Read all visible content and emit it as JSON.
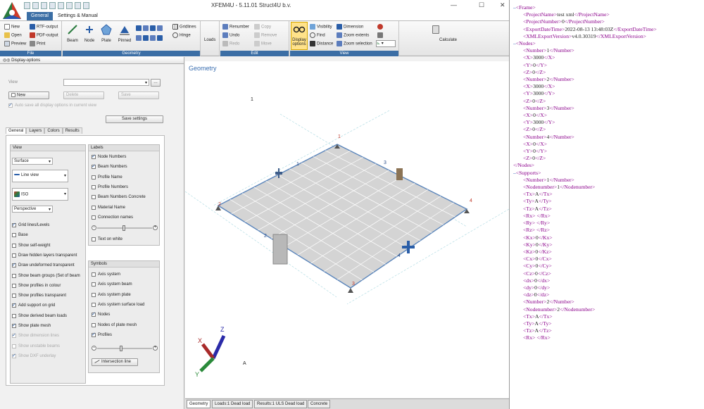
{
  "app": {
    "title": "XFEM4U  -  5.11.01     Struct4U b.v."
  },
  "window_controls": {
    "min": "—",
    "max": "☐",
    "close": "✕"
  },
  "tabs": [
    "General",
    "Settings & Manual"
  ],
  "ribbon": {
    "file": {
      "label": "File",
      "new": "New",
      "open": "Open",
      "preview": "Preview",
      "rtf": "RTF-output",
      "pdf": "PDF-output",
      "print": "Print"
    },
    "geometry": {
      "label": "Geometry",
      "beam": "Beam",
      "node": "Node",
      "plate": "Plate",
      "pinned": "Pinned",
      "gridlines": "Gridlines",
      "hinge": "Hinge"
    },
    "loads": {
      "label": "Loads"
    },
    "edit": {
      "label": "Edit",
      "renumber": "Renumber",
      "undo": "Undo",
      "redo": "Redo",
      "copy": "Copy",
      "remove": "Remove",
      "move": "Move"
    },
    "view": {
      "label": "View",
      "display_options": "Display options",
      "visibility": "Visibility",
      "find": "Find",
      "distance": "Distance",
      "dimension": "Dimension",
      "zoom_extents": "Zoom extents",
      "zoom_selection": "Zoom selection"
    },
    "calculate": {
      "label": "Calculate"
    }
  },
  "panel": {
    "title": "Display-options",
    "view_label": "View",
    "new_btn": "New",
    "delete_btn": "Delete",
    "save_btn": "Save",
    "auto_save": "Auto save all display options in current view",
    "save_settings": "Save settings",
    "tabs": [
      "General",
      "Layers",
      "Colors",
      "Results"
    ],
    "view_group": {
      "title": "View",
      "surface": "Surface",
      "line_view": "Line view",
      "iso": "ISO",
      "perspective": "Perspective"
    },
    "view_checks": [
      {
        "label": "Grid lines/Levels",
        "checked": true,
        "disabled": false
      },
      {
        "label": "Base",
        "checked": false,
        "disabled": false
      },
      {
        "label": "Show self-weight",
        "checked": false,
        "disabled": false
      },
      {
        "label": "Draw hidden layers transparent",
        "checked": false,
        "disabled": false
      },
      {
        "label": "Draw undeformed transparent",
        "checked": true,
        "disabled": false
      },
      {
        "label": "Show beam groups (Set of beam",
        "checked": false,
        "disabled": false
      },
      {
        "label": "Show profiles in colour",
        "checked": false,
        "disabled": false
      },
      {
        "label": "Show profiles transparent",
        "checked": false,
        "disabled": false
      },
      {
        "label": "Add support on grid",
        "checked": true,
        "disabled": false
      },
      {
        "label": "Show derived beam loads",
        "checked": false,
        "disabled": false
      },
      {
        "label": "Show plate mesh",
        "checked": true,
        "disabled": false
      },
      {
        "label": "Show dimension lines",
        "checked": true,
        "disabled": true
      },
      {
        "label": "Show unstable beams",
        "checked": false,
        "disabled": true
      },
      {
        "label": "Show DXF underlay",
        "checked": true,
        "disabled": true
      }
    ],
    "labels_group": {
      "title": "Labels",
      "checks": [
        {
          "label": "Node Numbers",
          "checked": true
        },
        {
          "label": "Beam Numbers",
          "checked": true
        },
        {
          "label": "Profile Name",
          "checked": false
        },
        {
          "label": "Profile Numbers",
          "checked": false
        },
        {
          "label": "Beam Numbers Concrete",
          "checked": false
        },
        {
          "label": "Material Name",
          "checked": false
        },
        {
          "label": "Connection names",
          "checked": false
        }
      ],
      "text_on_white": "Text on white"
    },
    "symbols_group": {
      "title": "Symbols",
      "checks": [
        {
          "label": "Axis system",
          "checked": false
        },
        {
          "label": "Axis system beam",
          "checked": false
        },
        {
          "label": "Axis system plate",
          "checked": false
        },
        {
          "label": "Axis system surface load",
          "checked": false
        },
        {
          "label": "Nodes",
          "checked": true
        },
        {
          "label": "Nodes of plate mesh",
          "checked": false
        },
        {
          "label": "Profiles",
          "checked": true
        }
      ],
      "intersection": "Intersection line"
    }
  },
  "viewport": {
    "label": "Geometry",
    "marker": "1",
    "node_labels": [
      "1",
      "2",
      "3",
      "4"
    ],
    "beam_labels": [
      "1",
      "2",
      "3",
      "4"
    ],
    "axes": {
      "x": "X",
      "y": "Y",
      "z": "Z"
    },
    "corner_label": "A"
  },
  "bottom_tabs": [
    "Geometry",
    "Loads:1 Dead load",
    "Results:1 ULS Dead load",
    "Concrete"
  ],
  "xml_lines": [
    {
      "indent": 0,
      "marker": "–",
      "text": "<Frame>"
    },
    {
      "indent": 1,
      "text": "<ProjectName>test xml</ProjectName>"
    },
    {
      "indent": 1,
      "text": "<ProjectNumber>0</ProjectNumber>"
    },
    {
      "indent": 1,
      "text": "<ExportDateTime>2022-08-13 13:48:03Z</ExportDateTime>"
    },
    {
      "indent": 1,
      "text": "<XMLExportVersion>v4.0.30319</XMLExportVersion>"
    },
    {
      "indent": 0,
      "marker": "–",
      "text": "<Nodes>"
    },
    {
      "indent": 1,
      "text": "<Number>1</Number>"
    },
    {
      "indent": 1,
      "text": "<X>3000</X>"
    },
    {
      "indent": 1,
      "text": "<Y>0</Y>"
    },
    {
      "indent": 1,
      "text": "<Z>0</Z>"
    },
    {
      "indent": 1,
      "text": "<Number>2</Number>"
    },
    {
      "indent": 1,
      "text": "<X>3000</X>"
    },
    {
      "indent": 1,
      "text": "<Y>3000</Y>"
    },
    {
      "indent": 1,
      "text": "<Z>0</Z>"
    },
    {
      "indent": 1,
      "text": "<Number>3</Number>"
    },
    {
      "indent": 1,
      "text": "<X>0</X>"
    },
    {
      "indent": 1,
      "text": "<Y>3000</Y>"
    },
    {
      "indent": 1,
      "text": "<Z>0</Z>"
    },
    {
      "indent": 1,
      "text": "<Number>4</Number>"
    },
    {
      "indent": 1,
      "text": "<X>0</X>"
    },
    {
      "indent": 1,
      "text": "<Y>0</Y>"
    },
    {
      "indent": 1,
      "text": "<Z>0</Z>"
    },
    {
      "indent": 0,
      "text": "</Nodes>"
    },
    {
      "indent": 0,
      "marker": "–",
      "text": "<Supports>"
    },
    {
      "indent": 1,
      "text": "<Number>1</Number>"
    },
    {
      "indent": 1,
      "text": "<Nodenumber>1</Nodenumber>"
    },
    {
      "indent": 1,
      "text": "<Tx>A</Tx>"
    },
    {
      "indent": 1,
      "text": "<Ty>A</Ty>"
    },
    {
      "indent": 1,
      "text": "<Tz>A</Tz>"
    },
    {
      "indent": 1,
      "text": "<Rx> </Rx>"
    },
    {
      "indent": 1,
      "text": "<Ry> </Ry>"
    },
    {
      "indent": 1,
      "text": "<Rz> </Rz>"
    },
    {
      "indent": 1,
      "text": "<Kx>0</Kx>"
    },
    {
      "indent": 1,
      "text": "<Ky>0</Ky>"
    },
    {
      "indent": 1,
      "text": "<Kz>0</Kz>"
    },
    {
      "indent": 1,
      "text": "<Cx>0</Cx>"
    },
    {
      "indent": 1,
      "text": "<Cy>0</Cy>"
    },
    {
      "indent": 1,
      "text": "<Cz>0</Cz>"
    },
    {
      "indent": 1,
      "text": "<dx>0</dx>"
    },
    {
      "indent": 1,
      "text": "<dy>0</dy>"
    },
    {
      "indent": 1,
      "text": "<dz>0</dz>"
    },
    {
      "indent": 1,
      "text": "<Number>2</Number>"
    },
    {
      "indent": 1,
      "text": "<Nodenumber>2</Nodenumber>"
    },
    {
      "indent": 1,
      "text": "<Tx>A</Tx>"
    },
    {
      "indent": 1,
      "text": "<Ty>A</Ty>"
    },
    {
      "indent": 1,
      "text": "<Tz>A</Tz>"
    },
    {
      "indent": 1,
      "text": "<Rx> </Rx>"
    }
  ],
  "colors": {
    "accent": "#3b6ea5",
    "xml_tag": "#8b008b",
    "viewport_label": "#3a6eb0"
  }
}
